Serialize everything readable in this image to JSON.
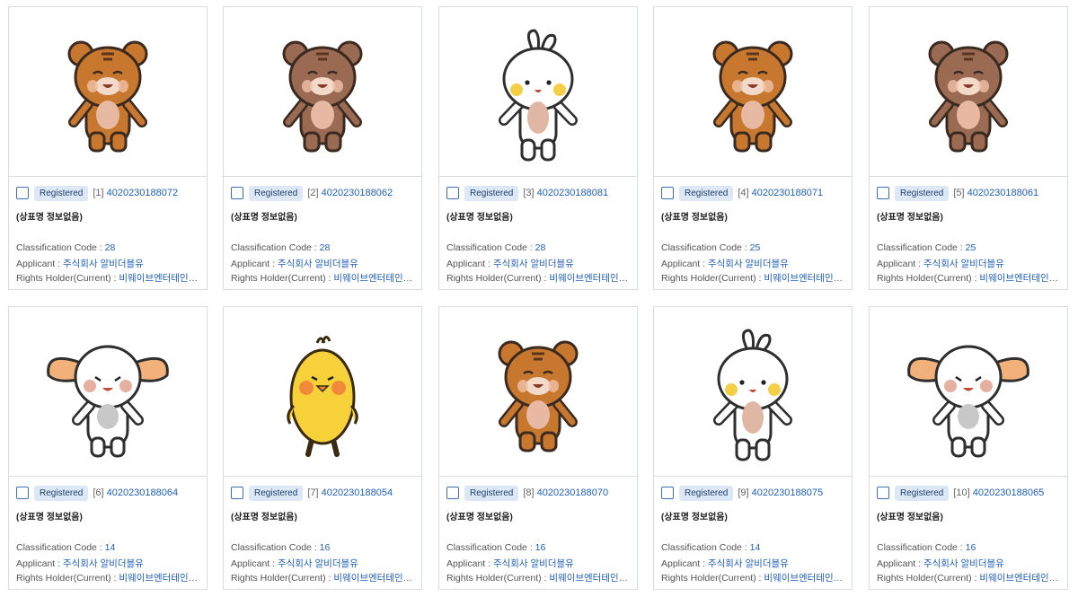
{
  "cards": [
    {
      "status": "Registered",
      "index": "[1]",
      "number": "4020230188072",
      "tm_name": "(상표명 정보없음)",
      "class_label": "Classification Code :",
      "class_value": "28",
      "applicant_label": "Applicant :",
      "applicant_value": "주식회사 알비더블유",
      "holder_label": "Rights Holder(Current) :",
      "holder_value": "비웨이브엔터테인먼트…",
      "image": "tiger-orange-icon"
    },
    {
      "status": "Registered",
      "index": "[2]",
      "number": "4020230188062",
      "tm_name": "(상표명 정보없음)",
      "class_label": "Classification Code :",
      "class_value": "28",
      "applicant_label": "Applicant :",
      "applicant_value": "주식회사 알비더블유",
      "holder_label": "Rights Holder(Current) :",
      "holder_value": "비웨이브엔터테인먼트…",
      "image": "tiger-brown-icon"
    },
    {
      "status": "Registered",
      "index": "[3]",
      "number": "4020230188081",
      "tm_name": "(상표명 정보없음)",
      "class_label": "Classification Code :",
      "class_value": "28",
      "applicant_label": "Applicant :",
      "applicant_value": "주식회사 알비더블유",
      "holder_label": "Rights Holder(Current) :",
      "holder_value": "비웨이브엔터테인먼트…",
      "image": "rabbit-icon"
    },
    {
      "status": "Registered",
      "index": "[4]",
      "number": "4020230188071",
      "tm_name": "(상표명 정보없음)",
      "class_label": "Classification Code :",
      "class_value": "25",
      "applicant_label": "Applicant :",
      "applicant_value": "주식회사 알비더블유",
      "holder_label": "Rights Holder(Current) :",
      "holder_value": "비웨이브엔터테인먼트…",
      "image": "tiger-orange-icon"
    },
    {
      "status": "Registered",
      "index": "[5]",
      "number": "4020230188061",
      "tm_name": "(상표명 정보없음)",
      "class_label": "Classification Code :",
      "class_value": "25",
      "applicant_label": "Applicant :",
      "applicant_value": "주식회사 알비더블유",
      "holder_label": "Rights Holder(Current) :",
      "holder_value": "비웨이브엔터테인먼트…",
      "image": "tiger-brown-icon"
    },
    {
      "status": "Registered",
      "index": "[6]",
      "number": "4020230188064",
      "tm_name": "(상표명 정보없음)",
      "class_label": "Classification Code :",
      "class_value": "14",
      "applicant_label": "Applicant :",
      "applicant_value": "주식회사 알비더블유",
      "holder_label": "Rights Holder(Current) :",
      "holder_value": "비웨이브엔터테인먼트…",
      "image": "puppy-icon"
    },
    {
      "status": "Registered",
      "index": "[7]",
      "number": "4020230188054",
      "tm_name": "(상표명 정보없음)",
      "class_label": "Classification Code :",
      "class_value": "16",
      "applicant_label": "Applicant :",
      "applicant_value": "주식회사 알비더블유",
      "holder_label": "Rights Holder(Current) :",
      "holder_value": "비웨이브엔터테인먼트…",
      "image": "chick-icon"
    },
    {
      "status": "Registered",
      "index": "[8]",
      "number": "4020230188070",
      "tm_name": "(상표명 정보없음)",
      "class_label": "Classification Code :",
      "class_value": "16",
      "applicant_label": "Applicant :",
      "applicant_value": "주식회사 알비더블유",
      "holder_label": "Rights Holder(Current) :",
      "holder_value": "비웨이브엔터테인먼트…",
      "image": "tiger-orange-icon"
    },
    {
      "status": "Registered",
      "index": "[9]",
      "number": "4020230188075",
      "tm_name": "(상표명 정보없음)",
      "class_label": "Classification Code :",
      "class_value": "14",
      "applicant_label": "Applicant :",
      "applicant_value": "주식회사 알비더블유",
      "holder_label": "Rights Holder(Current) :",
      "holder_value": "비웨이브엔터테인먼트…",
      "image": "rabbit-icon"
    },
    {
      "status": "Registered",
      "index": "[10]",
      "number": "4020230188065",
      "tm_name": "(상표명 정보없음)",
      "class_label": "Classification Code :",
      "class_value": "16",
      "applicant_label": "Applicant :",
      "applicant_value": "주식회사 알비더블유",
      "holder_label": "Rights Holder(Current) :",
      "holder_value": "비웨이브엔터테인먼트…",
      "image": "puppy-icon"
    }
  ],
  "colors": {
    "badge_bg": "#dce8f6",
    "link": "#1f5fbf",
    "tiger_orange": "#c8782e",
    "tiger_brown": "#9a6a52",
    "puppy_ear": "#f2b07a",
    "chick": "#f7d13a"
  }
}
